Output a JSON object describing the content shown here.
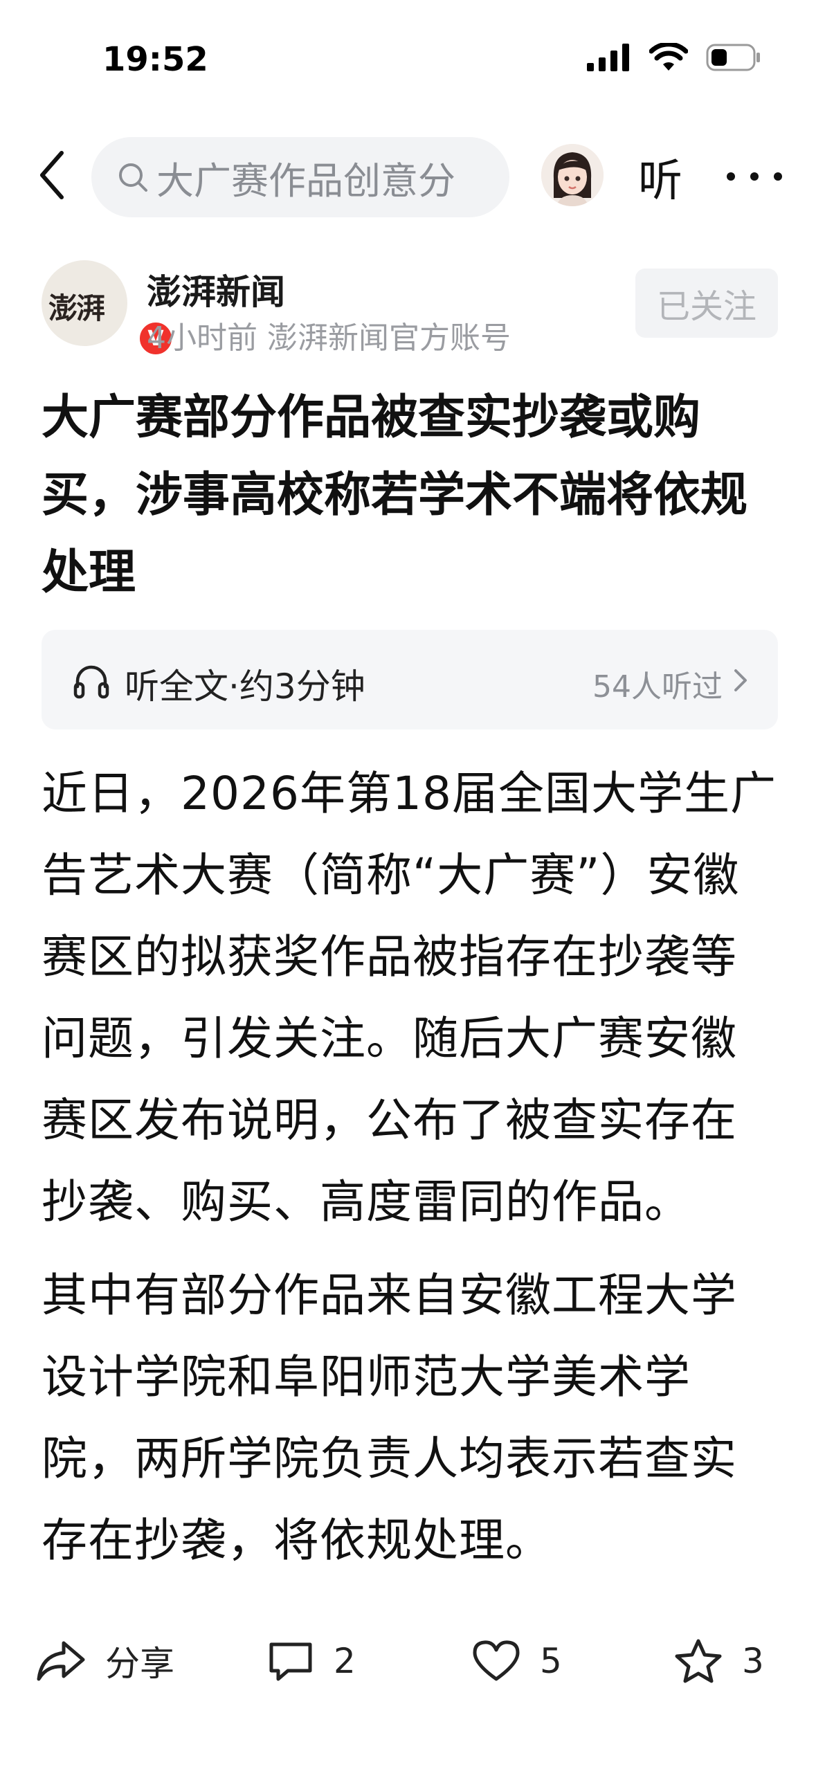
{
  "status_bar": {
    "time": "19:52"
  },
  "nav": {
    "search_text": "大广赛作品创意分",
    "listen_label": "听"
  },
  "author": {
    "logo_text": "澎湃",
    "name": "澎湃新闻",
    "meta": "4小时前  澎湃新闻官方账号",
    "follow_label": "已关注",
    "verified_mark": "V"
  },
  "article": {
    "title": "大广赛部分作品被查实抄袭或购买，涉事高校称若学术不端将依规处理",
    "listen_full": "听全文·约3分钟",
    "listen_count": "54人听过",
    "paragraphs": [
      "近日，2026年第18届全国大学生广告艺术大赛（简称“大广赛”）安徽赛区的拟获奖作品被指存在抄袭等问题，引发关注。随后大广赛安徽赛区发布说明，公布了被查实存在抄袭、购买、高度雷同的作品。",
      "其中有部分作品来自安徽工程大学设计学院和阜阳师范大学美术学院，两所学院负责人均表示若查实存在抄袭，将依规处理。"
    ]
  },
  "toolbar": {
    "share_label": "分享",
    "comment_count": "2",
    "like_count": "5",
    "favorite_count": "3"
  }
}
